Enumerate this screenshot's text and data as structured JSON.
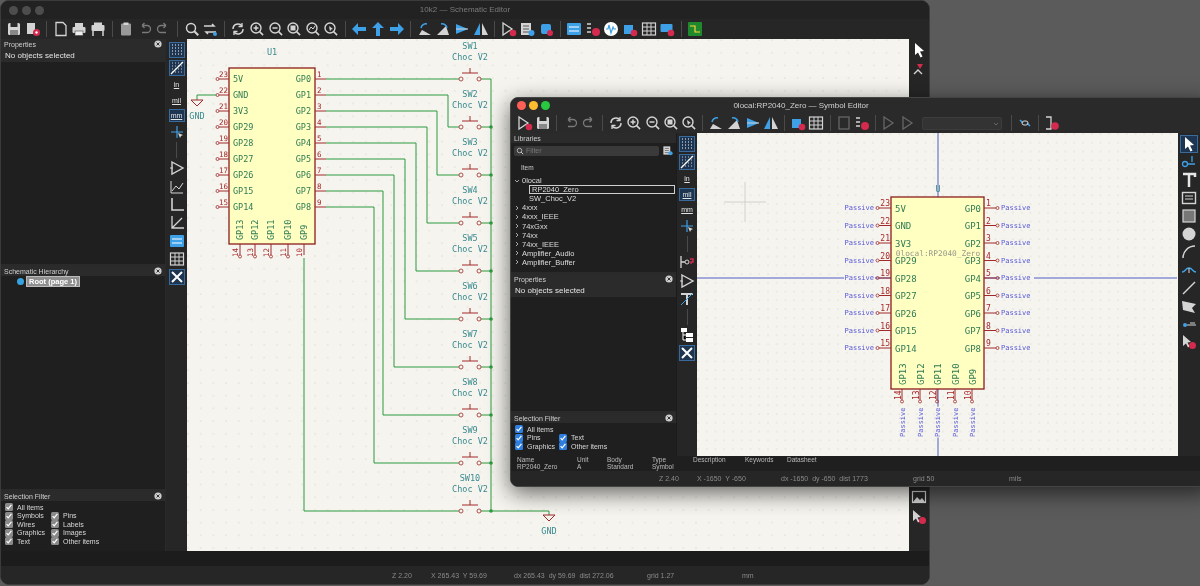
{
  "schematic_editor": {
    "title": "10k2 — Schematic Editor",
    "properties_panel": {
      "title": "Properties",
      "message": "No objects selected"
    },
    "hierarchy_panel": {
      "title": "Schematic Hierarchy",
      "items": [
        {
          "label": "Root (page 1)",
          "selected": true
        }
      ]
    },
    "selection_filter": {
      "title": "Selection Filter",
      "options": [
        {
          "label": "All items",
          "checked": true
        },
        {
          "label": "Symbols",
          "checked": true
        },
        {
          "label": "Pins",
          "checked": true
        },
        {
          "label": "Wires",
          "checked": true
        },
        {
          "label": "Labels",
          "checked": true
        },
        {
          "label": "Graphics",
          "checked": true
        },
        {
          "label": "Images",
          "checked": true
        },
        {
          "label": "Text",
          "checked": true
        },
        {
          "label": "Other items",
          "checked": true
        }
      ]
    },
    "units": [
      {
        "label": "in",
        "selected": false
      },
      {
        "label": "mil",
        "selected": false
      },
      {
        "label": "mm",
        "selected": true
      }
    ],
    "canvas": {
      "symbol": {
        "reference": "U1",
        "left_pins": [
          {
            "number": "23",
            "name": "5V"
          },
          {
            "number": "22",
            "name": "GND"
          },
          {
            "number": "21",
            "name": "3V3"
          },
          {
            "number": "20",
            "name": "GP29"
          },
          {
            "number": "19",
            "name": "GP28"
          },
          {
            "number": "18",
            "name": "GP27"
          },
          {
            "number": "17",
            "name": "GP26"
          },
          {
            "number": "16",
            "name": "GP15"
          },
          {
            "number": "15",
            "name": "GP14"
          }
        ],
        "right_pins": [
          {
            "number": "1",
            "name": "GP0"
          },
          {
            "number": "2",
            "name": "GP1"
          },
          {
            "number": "3",
            "name": "GP2"
          },
          {
            "number": "4",
            "name": "GP3"
          },
          {
            "number": "5",
            "name": "GP4"
          },
          {
            "number": "6",
            "name": "GP5"
          },
          {
            "number": "7",
            "name": "GP6"
          },
          {
            "number": "8",
            "name": "GP7"
          },
          {
            "number": "9",
            "name": "GP8"
          }
        ],
        "bottom_pins": [
          {
            "number": "14",
            "name": "GP13"
          },
          {
            "number": "13",
            "name": "GP12"
          },
          {
            "number": "12",
            "name": "GP11"
          },
          {
            "number": "11",
            "name": "GP10"
          },
          {
            "number": "10",
            "name": "GP9"
          }
        ]
      },
      "ground_labels": [
        "GND",
        "GND"
      ],
      "switches": [
        {
          "reference": "SW1",
          "value": "Choc V2"
        },
        {
          "reference": "SW2",
          "value": "Choc V2"
        },
        {
          "reference": "SW3",
          "value": "Choc V2"
        },
        {
          "reference": "SW4",
          "value": "Choc V2"
        },
        {
          "reference": "SW5",
          "value": "Choc V2"
        },
        {
          "reference": "SW6",
          "value": "Choc V2"
        },
        {
          "reference": "SW7",
          "value": "Choc V2"
        },
        {
          "reference": "SW8",
          "value": "Choc V2"
        },
        {
          "reference": "SW9",
          "value": "Choc V2"
        },
        {
          "reference": "SW10",
          "value": "Choc V2"
        }
      ]
    },
    "status_bar": [
      "Z 2.20",
      "X 265.43  Y 59.69",
      "dx 265.43  dy 59.69  dist 272.06",
      "grid 1.27",
      "mm"
    ]
  },
  "symbol_editor": {
    "title": "0local:RP2040_Zero — Symbol Editor",
    "libraries_panel": {
      "title": "Libraries",
      "filter_placeholder": "Filter",
      "column": "Item",
      "tree": [
        {
          "label": "0local",
          "expanded": true,
          "selected": false,
          "children": [
            {
              "label": "RP2040_Zero",
              "selected": true
            },
            {
              "label": "SW_Choc_V2",
              "selected": false
            }
          ]
        },
        {
          "label": "4xxx",
          "expanded": false,
          "selected": false
        },
        {
          "label": "4xxx_IEEE",
          "expanded": false,
          "selected": false
        },
        {
          "label": "74xGxx",
          "expanded": false,
          "selected": false
        },
        {
          "label": "74xx",
          "expanded": false,
          "selected": false
        },
        {
          "label": "74xx_IEEE",
          "expanded": false,
          "selected": false
        },
        {
          "label": "Amplifier_Audio",
          "expanded": false,
          "selected": false
        },
        {
          "label": "Amplifier_Buffer",
          "expanded": false,
          "selected": false
        }
      ]
    },
    "properties_panel": {
      "title": "Properties",
      "message": "No objects selected"
    },
    "selection_filter": {
      "title": "Selection Filter",
      "options": [
        {
          "label": "All items",
          "checked": true
        },
        {
          "label": "Pins",
          "checked": true
        },
        {
          "label": "Text",
          "checked": true
        },
        {
          "label": "Graphics",
          "checked": true
        },
        {
          "label": "Other items",
          "checked": true
        }
      ]
    },
    "symbol_info": [
      {
        "header": "Name",
        "value": "RP2040_Zero"
      },
      {
        "header": "Unit",
        "value": "A"
      },
      {
        "header": "Body",
        "value": "Standard"
      },
      {
        "header": "Type",
        "value": "Symbol"
      },
      {
        "header": "Description"
      },
      {
        "header": "Keywords"
      },
      {
        "header": "Datasheet"
      }
    ],
    "units": [
      {
        "label": "in",
        "selected": false
      },
      {
        "label": "mil",
        "selected": true
      },
      {
        "label": "mm",
        "selected": false
      }
    ],
    "canvas": {
      "reference": "U",
      "value": "0local:RP2040_Zero",
      "left_pins": [
        {
          "number": "23",
          "name": "5V",
          "type": "Passive"
        },
        {
          "number": "22",
          "name": "GND",
          "type": "Passive"
        },
        {
          "number": "21",
          "name": "3V3",
          "type": "Passive"
        },
        {
          "number": "20",
          "name": "GP29",
          "type": "Passive"
        },
        {
          "number": "19",
          "name": "GP28",
          "type": "Passive"
        },
        {
          "number": "18",
          "name": "GP27",
          "type": "Passive"
        },
        {
          "number": "17",
          "name": "GP26",
          "type": "Passive"
        },
        {
          "number": "16",
          "name": "GP15",
          "type": "Passive"
        },
        {
          "number": "15",
          "name": "GP14",
          "type": "Passive"
        }
      ],
      "right_pins": [
        {
          "number": "1",
          "name": "GP0",
          "type": "Passive"
        },
        {
          "number": "2",
          "name": "GP1",
          "type": "Passive"
        },
        {
          "number": "3",
          "name": "GP2",
          "type": "Passive"
        },
        {
          "number": "4",
          "name": "GP3",
          "type": "Passive"
        },
        {
          "number": "5",
          "name": "GP4",
          "type": "Passive"
        },
        {
          "number": "6",
          "name": "GP5",
          "type": "Passive"
        },
        {
          "number": "7",
          "name": "GP6",
          "type": "Passive"
        },
        {
          "number": "8",
          "name": "GP7",
          "type": "Passive"
        },
        {
          "number": "9",
          "name": "GP8",
          "type": "Passive"
        }
      ],
      "bottom_pins": [
        {
          "number": "14",
          "name": "GP13",
          "type": "Passive"
        },
        {
          "number": "13",
          "name": "GP12",
          "type": "Passive"
        },
        {
          "number": "12",
          "name": "GP11",
          "type": "Passive"
        },
        {
          "number": "11",
          "name": "GP10",
          "type": "Passive"
        },
        {
          "number": "10",
          "name": "GP9",
          "type": "Passive"
        }
      ]
    },
    "status_bar": [
      "Z 2.40",
      "X -1650  Y -650",
      "dx -1650  dy -650  dist 1773",
      "grid 50",
      "mils"
    ]
  }
}
